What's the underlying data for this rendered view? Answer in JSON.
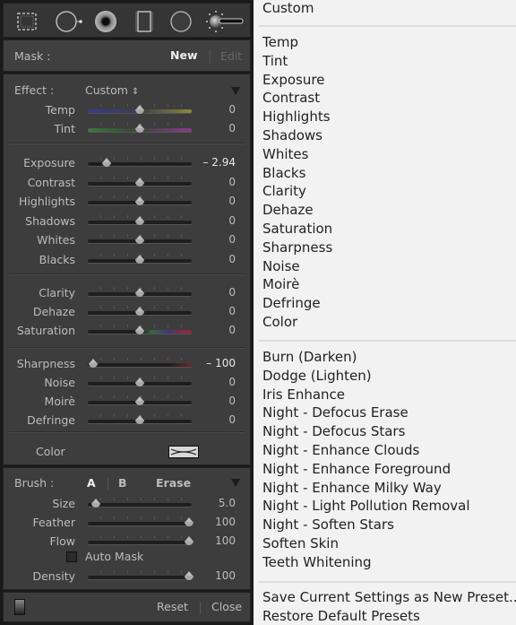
{
  "toolbar": {
    "tools": [
      {
        "icon": "crop-overlay-icon"
      },
      {
        "icon": "spot-removal-icon"
      },
      {
        "icon": "red-eye-icon"
      },
      {
        "icon": "graduated-filter-icon"
      },
      {
        "icon": "radial-filter-icon"
      },
      {
        "icon": "adjustment-brush-icon"
      }
    ]
  },
  "mask": {
    "label": "Mask :",
    "new_label": "New",
    "edit_label": "Edit"
  },
  "effect": {
    "label": "Effect :",
    "preset": "Custom",
    "preset_icon": "⇕",
    "sliders_wb": [
      {
        "label": "Temp",
        "value": "0",
        "position": 0.5
      },
      {
        "label": "Tint",
        "value": "0",
        "position": 0.5
      }
    ],
    "sliders_tone": [
      {
        "label": "Exposure",
        "value": "– 2.94",
        "position": 0.18
      },
      {
        "label": "Contrast",
        "value": "0",
        "position": 0.5
      },
      {
        "label": "Highlights",
        "value": "0",
        "position": 0.5
      },
      {
        "label": "Shadows",
        "value": "0",
        "position": 0.5
      },
      {
        "label": "Whites",
        "value": "0",
        "position": 0.5
      },
      {
        "label": "Blacks",
        "value": "0",
        "position": 0.5
      }
    ],
    "sliders_presence": [
      {
        "label": "Clarity",
        "value": "0",
        "position": 0.5
      },
      {
        "label": "Dehaze",
        "value": "0",
        "position": 0.5
      },
      {
        "label": "Saturation",
        "value": "0",
        "position": 0.5
      }
    ],
    "sliders_detail": [
      {
        "label": "Sharpness",
        "value": "– 100",
        "position": 0.05
      },
      {
        "label": "Noise",
        "value": "0",
        "position": 0.5
      },
      {
        "label": "Moirè",
        "value": "0",
        "position": 0.5
      },
      {
        "label": "Defringe",
        "value": "0",
        "position": 0.5
      }
    ],
    "color_label": "Color"
  },
  "brush": {
    "label": "Brush :",
    "tab_a": "A",
    "tab_b": "B",
    "tab_erase": "Erase",
    "sliders": [
      {
        "label": "Size",
        "value": "5.0",
        "position": 0.08
      },
      {
        "label": "Feather",
        "value": "100",
        "position": 0.97
      },
      {
        "label": "Flow",
        "value": "100",
        "position": 0.97
      }
    ],
    "auto_mask_label": "Auto Mask",
    "auto_mask_checked": false,
    "density": {
      "label": "Density",
      "value": "100",
      "position": 0.97
    }
  },
  "footer": {
    "reset_label": "Reset",
    "close_label": "Close"
  },
  "menu": {
    "current": "Custom",
    "group1": [
      "Temp",
      "Tint",
      "Exposure",
      "Contrast",
      "Highlights",
      "Shadows",
      "Whites",
      "Blacks",
      "Clarity",
      "Dehaze",
      "Saturation",
      "Sharpness",
      "Noise",
      "Moirè",
      "Defringe",
      "Color"
    ],
    "group2": [
      "Burn (Darken)",
      "Dodge (Lighten)",
      "Iris Enhance",
      "Night - Defocus Erase",
      "Night - Defocus Stars",
      "Night - Enhance Clouds",
      "Night - Enhance Foreground",
      "Night - Enhance Milky Way",
      "Night - Light Pollution Removal",
      "Night - Soften Stars",
      "Soften Skin",
      "Teeth Whitening"
    ],
    "group3": [
      "Save Current Settings as New Preset...",
      "Restore Default Presets"
    ]
  },
  "colors": {
    "panel_bg": "#3d3d3d",
    "menu_bg": "#f2f2f2",
    "text_light": "#bcbcbc",
    "text_active": "#eeeeee"
  }
}
